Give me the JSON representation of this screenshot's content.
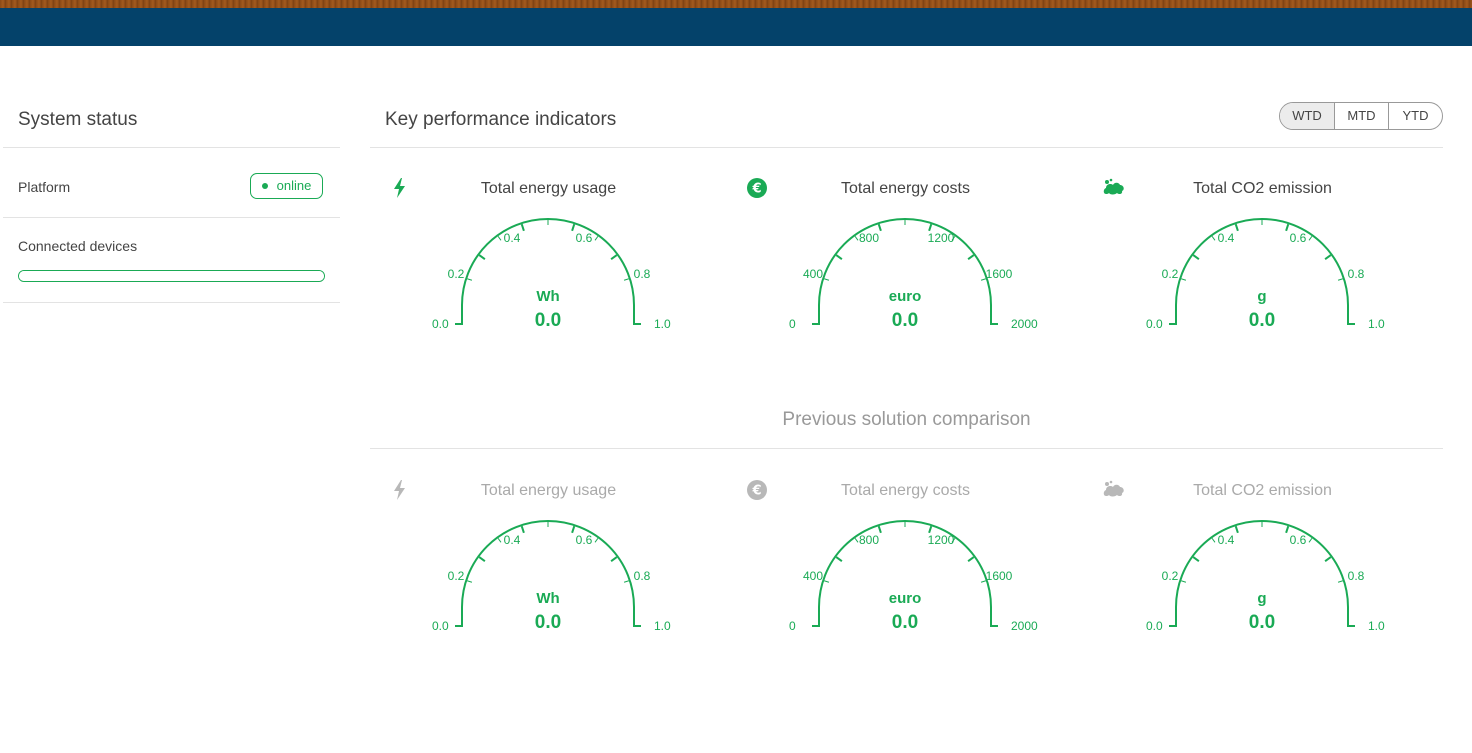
{
  "colors": {
    "accent": "#1aaa55",
    "header_bar": "#04426a",
    "muted": "#aaaaaa",
    "text": "#444444"
  },
  "system_status": {
    "title": "System status",
    "platform_label": "Platform",
    "platform_status": "online",
    "devices_label": "Connected devices",
    "devices_progress": 1.0
  },
  "kpi": {
    "title": "Key performance indicators",
    "periods": [
      "WTD",
      "MTD",
      "YTD"
    ],
    "active_period": "WTD"
  },
  "comparison": {
    "title": "Previous solution comparison"
  },
  "gauges": {
    "current": [
      {
        "title": "Total energy usage",
        "icon": "lightning-icon",
        "unit": "Wh",
        "value": "0.0",
        "ticks": [
          "0.0",
          "0.2",
          "0.4",
          "0.6",
          "0.8",
          "1.0"
        ]
      },
      {
        "title": "Total energy costs",
        "icon": "euro-icon",
        "unit": "euro",
        "value": "0.0",
        "ticks": [
          "0",
          "400",
          "800",
          "1200",
          "1600",
          "2000"
        ]
      },
      {
        "title": "Total CO2 emission",
        "icon": "cloud-icon",
        "unit": "g",
        "value": "0.0",
        "ticks": [
          "0.0",
          "0.2",
          "0.4",
          "0.6",
          "0.8",
          "1.0"
        ]
      }
    ],
    "previous": [
      {
        "title": "Total energy usage",
        "icon": "lightning-icon",
        "unit": "Wh",
        "value": "0.0",
        "ticks": [
          "0.0",
          "0.2",
          "0.4",
          "0.6",
          "0.8",
          "1.0"
        ]
      },
      {
        "title": "Total energy costs",
        "icon": "euro-icon",
        "unit": "euro",
        "value": "0.0",
        "ticks": [
          "0",
          "400",
          "800",
          "1200",
          "1600",
          "2000"
        ]
      },
      {
        "title": "Total CO2 emission",
        "icon": "cloud-icon",
        "unit": "g",
        "value": "0.0",
        "ticks": [
          "0.0",
          "0.2",
          "0.4",
          "0.6",
          "0.8",
          "1.0"
        ]
      }
    ]
  }
}
